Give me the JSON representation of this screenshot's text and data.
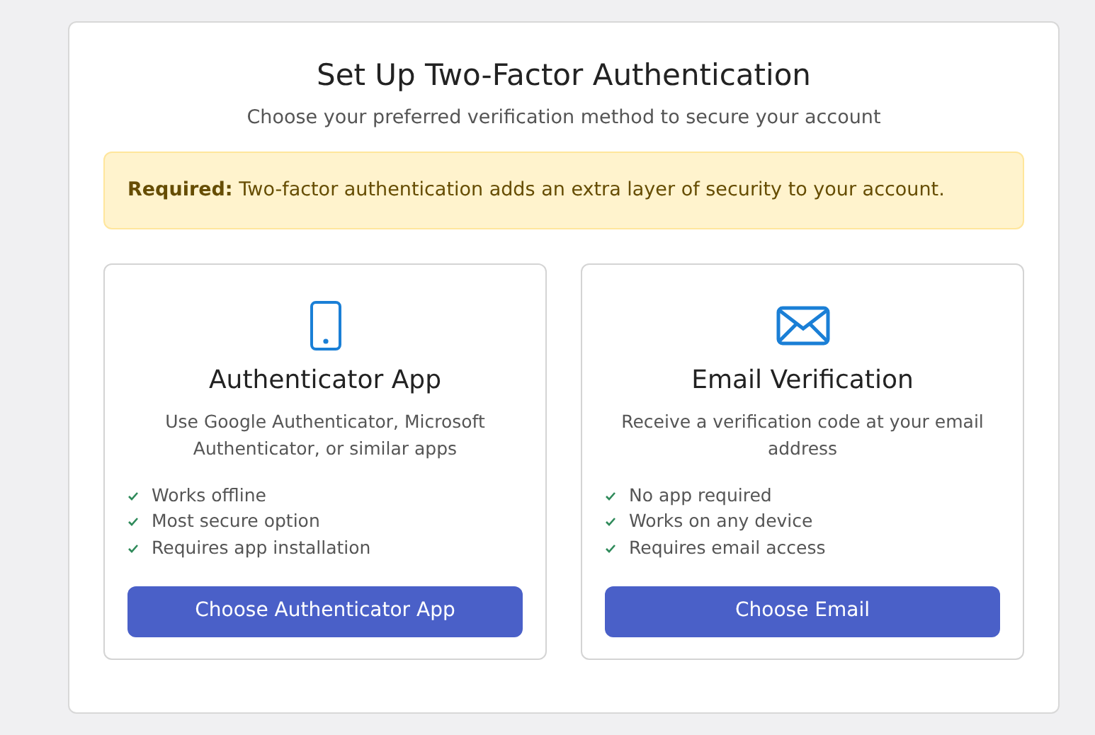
{
  "title": "Set Up Two-Factor Authentication",
  "subtitle": "Choose your preferred verification method to secure your account",
  "alert": {
    "text": "**Required:** Two-factor authentication adds an extra layer of security to your account."
  },
  "methods": [
    {
      "kind": "phone",
      "name": "Authenticator App",
      "description": "Use Google Authenticator, Microsoft Authenticator, or similar apps",
      "features": [
        "Works offline",
        "Most secure option",
        "Requires app installation"
      ],
      "button": "Choose Authenticator App"
    },
    {
      "kind": "envelope",
      "name": "Email Verification",
      "description": "Receive a verification code at your email address",
      "features": [
        "No app required",
        "Works on any device",
        "Requires email access"
      ],
      "button": "Choose Email"
    }
  ]
}
